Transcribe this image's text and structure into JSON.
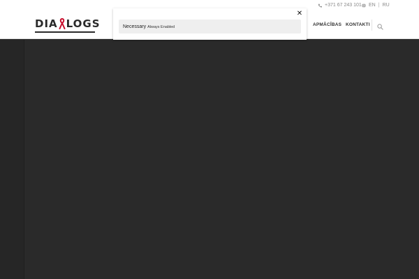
{
  "topbar": {
    "phone": "+371 67 243 101",
    "lang_en": "EN",
    "lang_sep": "|",
    "lang_ru": "RU"
  },
  "header": {
    "logo_left": "DIA",
    "logo_right": "LOGS",
    "nav": [
      {
        "label": "APMĀCĪBAS"
      },
      {
        "label": "KONTAKTI"
      }
    ]
  },
  "consent": {
    "close_label": "✕",
    "category_title": "Necessary",
    "category_status": "Always Enabled"
  },
  "colors": {
    "ribbon": "#c8102e",
    "page_background": "#2a2a2a"
  }
}
